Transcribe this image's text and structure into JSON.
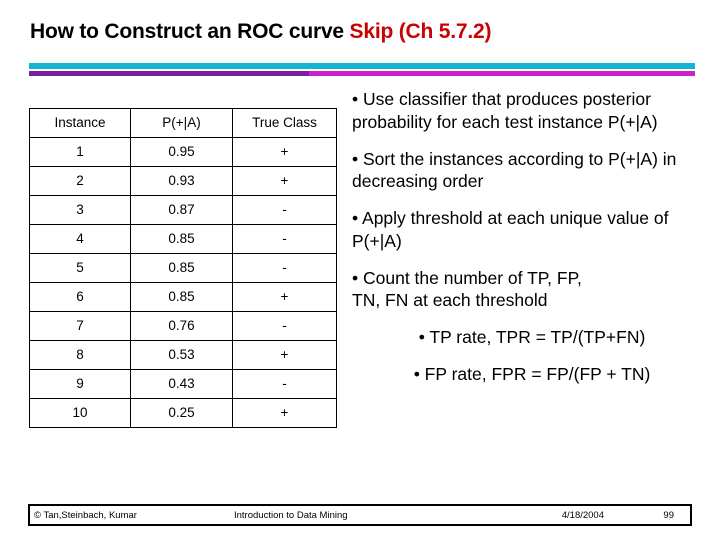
{
  "title": {
    "main": "How to Construct an ROC curve ",
    "accent": "Skip (Ch 5.7.2)"
  },
  "colors": {
    "accent_red": "#cc0000",
    "bar_teal": "#14b5d0",
    "bar_purple": "#7b1fa2",
    "bar_magenta": "#cc22cc",
    "text": "#000000",
    "background": "#ffffff"
  },
  "table": {
    "columns": [
      "Instance",
      "P(+|A)",
      "True Class"
    ],
    "rows": [
      [
        "1",
        "0.95",
        "+"
      ],
      [
        "2",
        "0.93",
        "+"
      ],
      [
        "3",
        "0.87",
        "-"
      ],
      [
        "4",
        "0.85",
        "-"
      ],
      [
        "5",
        "0.85",
        "-"
      ],
      [
        "6",
        "0.85",
        "+"
      ],
      [
        "7",
        "0.76",
        "-"
      ],
      [
        "8",
        "0.53",
        "+"
      ],
      [
        "9",
        "0.43",
        "-"
      ],
      [
        "10",
        "0.25",
        "+"
      ]
    ]
  },
  "bullets": [
    "• Use classifier that produces posterior probability for each test instance P(+|A)",
    "• Sort the instances according to P(+|A) in decreasing order",
    "• Apply threshold at each unique value of P(+|A)",
    "• Count the number of TP, FP,\n   TN, FN at each threshold",
    "• TP rate, TPR = TP/(TP+FN)",
    "• FP rate, FPR = FP/(FP + TN)"
  ],
  "footer": {
    "copyright": "© Tan,Steinbach, Kumar",
    "center": "Introduction to Data Mining",
    "date": "4/18/2004",
    "page": "99"
  }
}
